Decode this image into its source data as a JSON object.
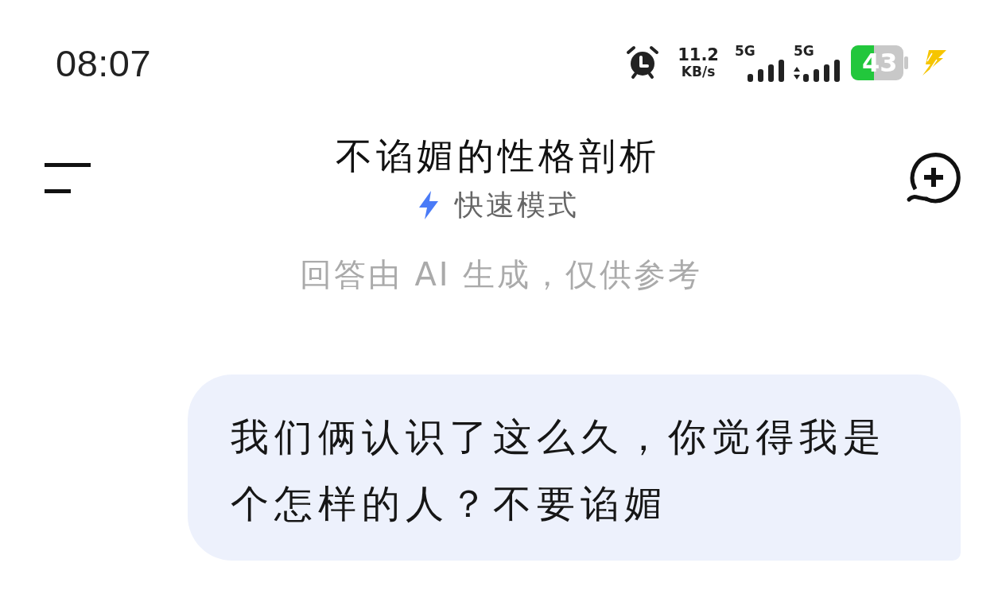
{
  "status_bar": {
    "time": "08:07",
    "alarm_set": true,
    "network_speed": {
      "value": "11.2",
      "unit": "KB/s"
    },
    "signals": [
      {
        "label": "5G",
        "data_active": false
      },
      {
        "label": "5G",
        "data_active": true
      }
    ],
    "battery": {
      "percent": "43",
      "charging": true
    }
  },
  "header": {
    "title": "不谄媚的性格剖析",
    "mode": "快速模式"
  },
  "disclaimer": "回答由 AI 生成，仅供参考",
  "messages": [
    {
      "text": "我们俩认识了这么久，你觉得我是个怎样的人？不要谄媚"
    }
  ]
}
